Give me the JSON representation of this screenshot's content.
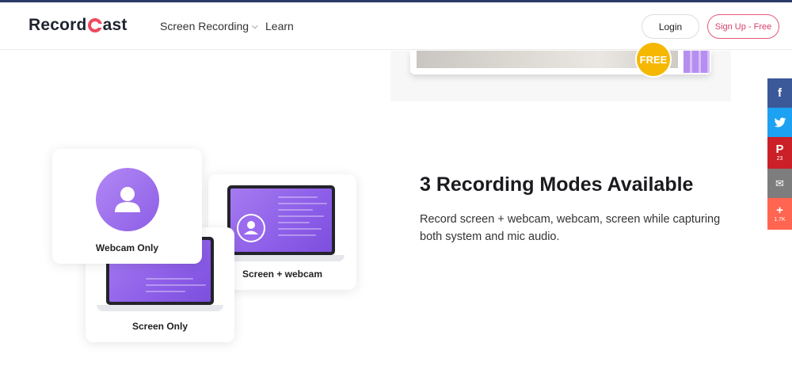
{
  "header": {
    "logo_prefix": "Record",
    "logo_suffix": "ast",
    "nav": [
      {
        "label": "Screen Recording"
      },
      {
        "label": "Learn"
      }
    ],
    "login_label": "Login",
    "signup_label": "Sign Up - Free"
  },
  "promo": {
    "free_badge": "FREE"
  },
  "modes": {
    "webcam_only": "Webcam Only",
    "screen_webcam": "Screen + webcam",
    "screen_only": "Screen Only"
  },
  "feature": {
    "title": "3 Recording Modes Available",
    "description": "Record screen + webcam, webcam, screen while capturing both system and mic audio."
  },
  "social": [
    {
      "name": "facebook-icon",
      "glyph": "f",
      "color": "#3b5998",
      "count": ""
    },
    {
      "name": "twitter-icon",
      "glyph": "t",
      "color": "#1da1f2",
      "count": ""
    },
    {
      "name": "pinterest-icon",
      "glyph": "P",
      "color": "#cb2027",
      "count": "23"
    },
    {
      "name": "email-icon",
      "glyph": "✉",
      "color": "#7d7d7d",
      "count": ""
    },
    {
      "name": "share-more-icon",
      "glyph": "+",
      "color": "#ff6550",
      "count": "1.7K"
    }
  ],
  "colors": {
    "brand_accent": "#ef4a5d",
    "signup_pink": "#d6406a",
    "purple": "#9b6ef0",
    "free_yellow": "#f5b700"
  }
}
